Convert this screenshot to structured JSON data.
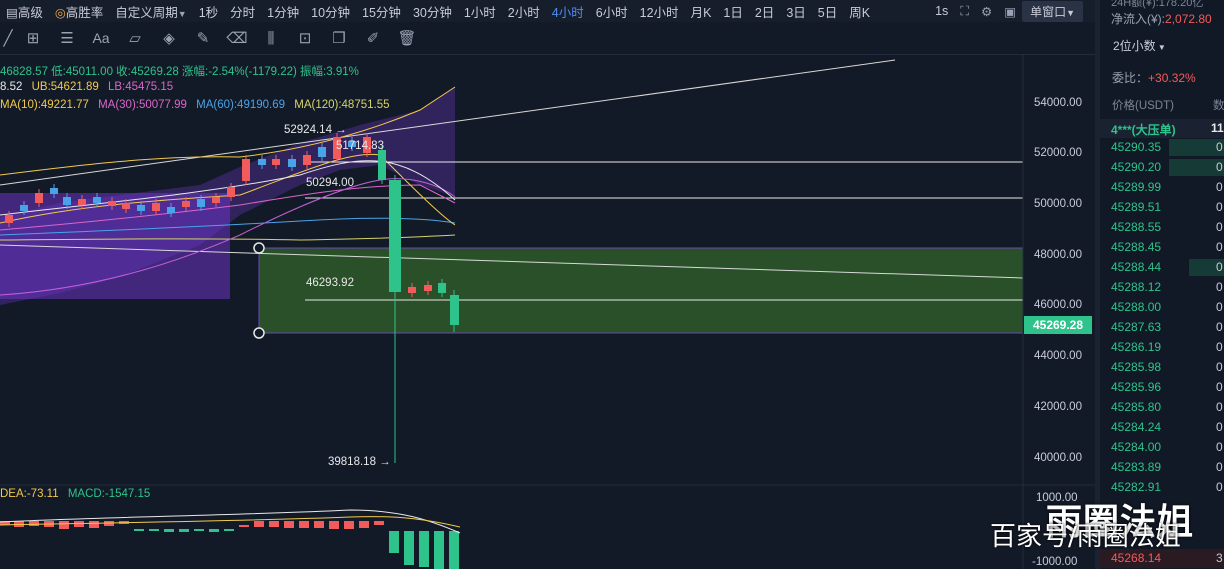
{
  "topbar": {
    "advanced": "高级",
    "high_win": "高胜率",
    "custom_period": "自定义周期",
    "periods": [
      "1秒",
      "分时",
      "1分钟",
      "10分钟",
      "15分钟",
      "30分钟",
      "1小时",
      "2小时",
      "4小时",
      "6小时",
      "12小时",
      "月K",
      "1日",
      "2日",
      "3日",
      "5日",
      "周K"
    ],
    "active_period": "4小时",
    "interval": "1s",
    "window_btn": "单窗口"
  },
  "toolbar": {
    "font_label": "Aa"
  },
  "legend": {
    "ohlc": "46828.57  低:45011.00  收:45269.28  涨幅:-2.54%(-1179.22)  振幅:3.91%",
    "boll_mid": "8.52",
    "boll_ub": "UB:54621.89",
    "boll_lb": "LB:45475.15",
    "ma10": "MA(10):49221.77",
    "ma30": "MA(30):50077.99",
    "ma60": "MA(60):49190.69",
    "ma120": "MA(120):48751.55",
    "macd_dea": "DEA:-73.11",
    "macd_val": "MACD:-1547.15"
  },
  "annotations": {
    "high_label": "52924.14 →",
    "level_51714": "51714.83",
    "level_50294": "50294.00",
    "level_46293": "46293.92",
    "low_label": "39818.18 →"
  },
  "axis": {
    "price_ticks": [
      "54000.00",
      "52000.00",
      "50000.00",
      "48000.00",
      "46000.00",
      "44000.00",
      "42000.00",
      "40000.00"
    ],
    "current_price": "45269.28",
    "macd_ticks": [
      "1000.00",
      "-1000.00"
    ]
  },
  "orderbook": {
    "top_stat": "24H额(¥):",
    "top_stat_val": "178.20亿",
    "net_inflow_label": "净流入(¥):",
    "net_inflow_value": "2,072.80",
    "decimals": "2位小数",
    "ratio_label": "委比：",
    "ratio_value": "+30.32%",
    "col_price": "价格(USDT)",
    "col_qty": "数",
    "big_order": "4***(大压单)",
    "big_order_qty": "11",
    "rows": [
      {
        "price": "45290.35",
        "qty": "0"
      },
      {
        "price": "45290.20",
        "qty": "0"
      },
      {
        "price": "45289.99",
        "qty": "0"
      },
      {
        "price": "45289.51",
        "qty": "0"
      },
      {
        "price": "45288.55",
        "qty": "0"
      },
      {
        "price": "45288.45",
        "qty": "0"
      },
      {
        "price": "45288.44",
        "qty": "0"
      },
      {
        "price": "45288.12",
        "qty": "0"
      },
      {
        "price": "45288.00",
        "qty": "0"
      },
      {
        "price": "45287.63",
        "qty": "0"
      },
      {
        "price": "45286.19",
        "qty": "0"
      },
      {
        "price": "45285.98",
        "qty": "0"
      },
      {
        "price": "45285.96",
        "qty": "0"
      },
      {
        "price": "45285.80",
        "qty": "0"
      },
      {
        "price": "45284.24",
        "qty": "0"
      },
      {
        "price": "45284.00",
        "qty": "0"
      },
      {
        "price": "45283.89",
        "qty": "0"
      },
      {
        "price": "45282.91",
        "qty": "0"
      }
    ],
    "last_row_price": "45268.14",
    "last_row_qty": "3"
  },
  "watermark": {
    "top": "雨圈法姐",
    "bottom": "百家号/雨圈法姐"
  },
  "colors": {
    "up": "#2ec38b",
    "down": "#f25b5b",
    "accent": "#4e8df5",
    "ub": "#f2c94c",
    "ma30": "#d966c9",
    "ma60": "#4aa3e8",
    "ma120": "#d4d36a"
  }
}
